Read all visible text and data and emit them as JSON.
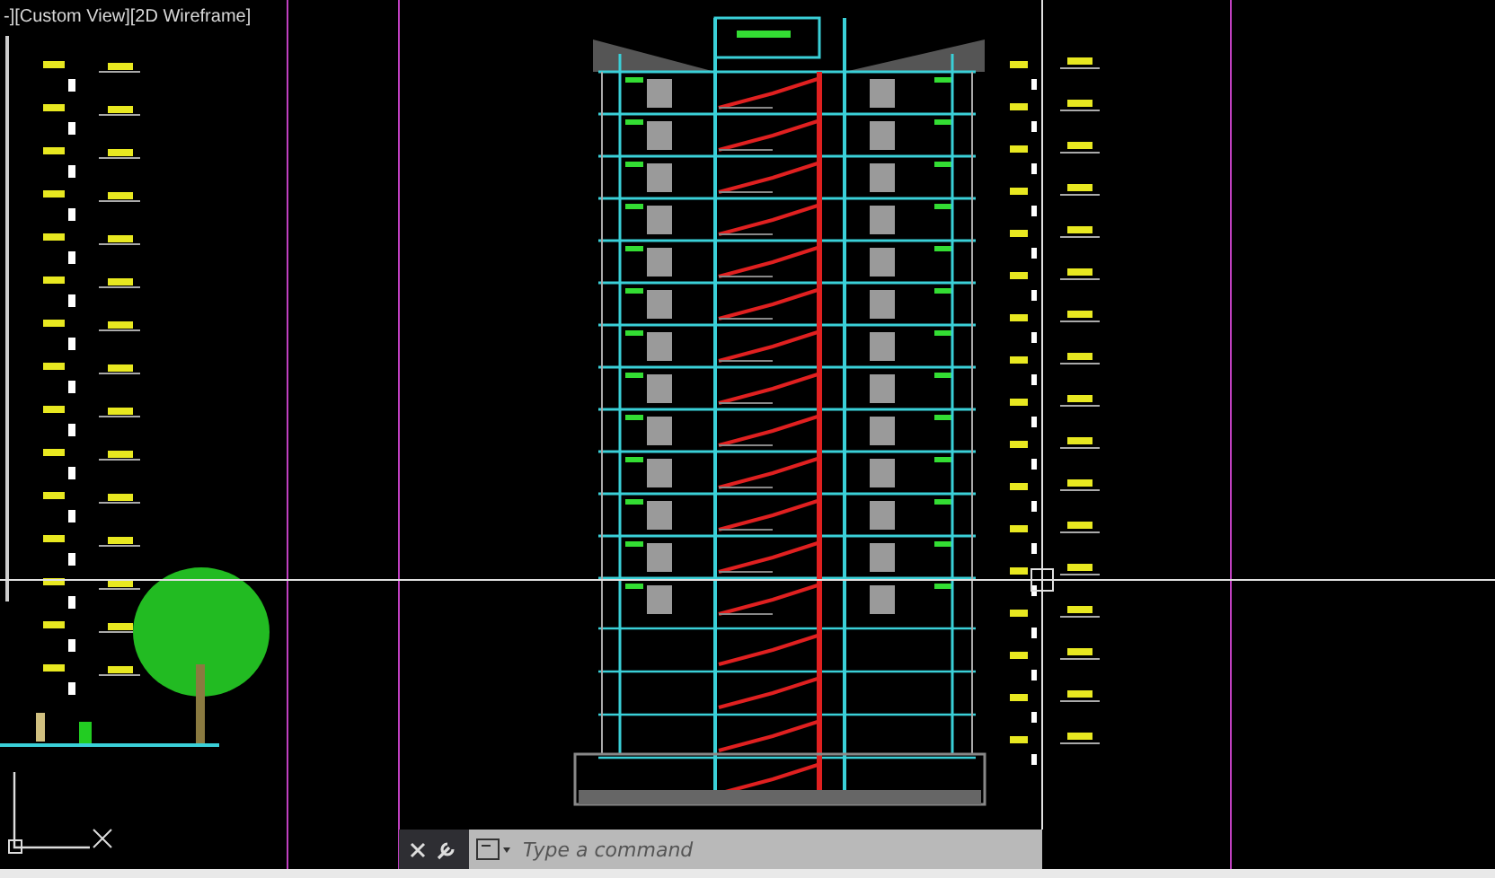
{
  "viewport": {
    "label": "-][Custom View][2D Wireframe]"
  },
  "command_line": {
    "placeholder": "Type a command"
  }
}
